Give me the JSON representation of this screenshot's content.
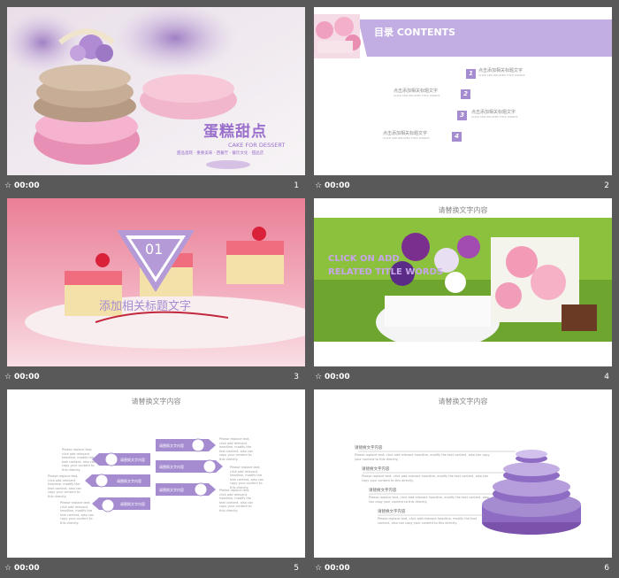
{
  "slides": [
    {
      "number": "1",
      "time": "00:00",
      "title": "蛋糕甜点",
      "subtitle": "CAKE FOR DESSERT",
      "tags": "甜品蛋糕 · 重要美味 · 西餐厅 · 餐饮文化 · 甜品店"
    },
    {
      "number": "2",
      "time": "00:00",
      "header": "目录 CONTENTS",
      "items": [
        {
          "num": "1",
          "label": "点击添加相关标题文字",
          "sub": "CLICK ADD RELATED TITLE WORDS"
        },
        {
          "num": "2",
          "label": "点击添加相关标题文字",
          "sub": "CLICK ADD RELATED TITLE WORDS"
        },
        {
          "num": "3",
          "label": "点击添加相关标题文字",
          "sub": "CLICK ADD RELATED TITLE WORDS"
        },
        {
          "num": "4",
          "label": "点击添加相关标题文字",
          "sub": "CLICK ADD RELATED TITLE WORDS"
        }
      ]
    },
    {
      "number": "3",
      "time": "00:00",
      "badge": "01",
      "title": "添加相关标题文字"
    },
    {
      "number": "4",
      "time": "00:00",
      "header": "请替换文字内容",
      "overlay_line1": "CLICK ON ADD",
      "overlay_line2": "RELATED TITLE WORDS"
    },
    {
      "number": "5",
      "time": "00:00",
      "header": "请替换文字内容",
      "label": "请替换文字内容",
      "body": "Please replace text, click add relevant headline, modify the text content, also can copy your content to this directly."
    },
    {
      "number": "6",
      "time": "00:00",
      "header": "请替换文字内容",
      "label": "请替换文字内容",
      "body": "Please replace text, click add relevant headline, modify the text content, also can copy your content to this directly."
    }
  ],
  "colors": {
    "accent": "#a58bd0",
    "accent_dark": "#8e6cc4",
    "accent_light": "#c9b6ea",
    "frame": "#595959"
  }
}
